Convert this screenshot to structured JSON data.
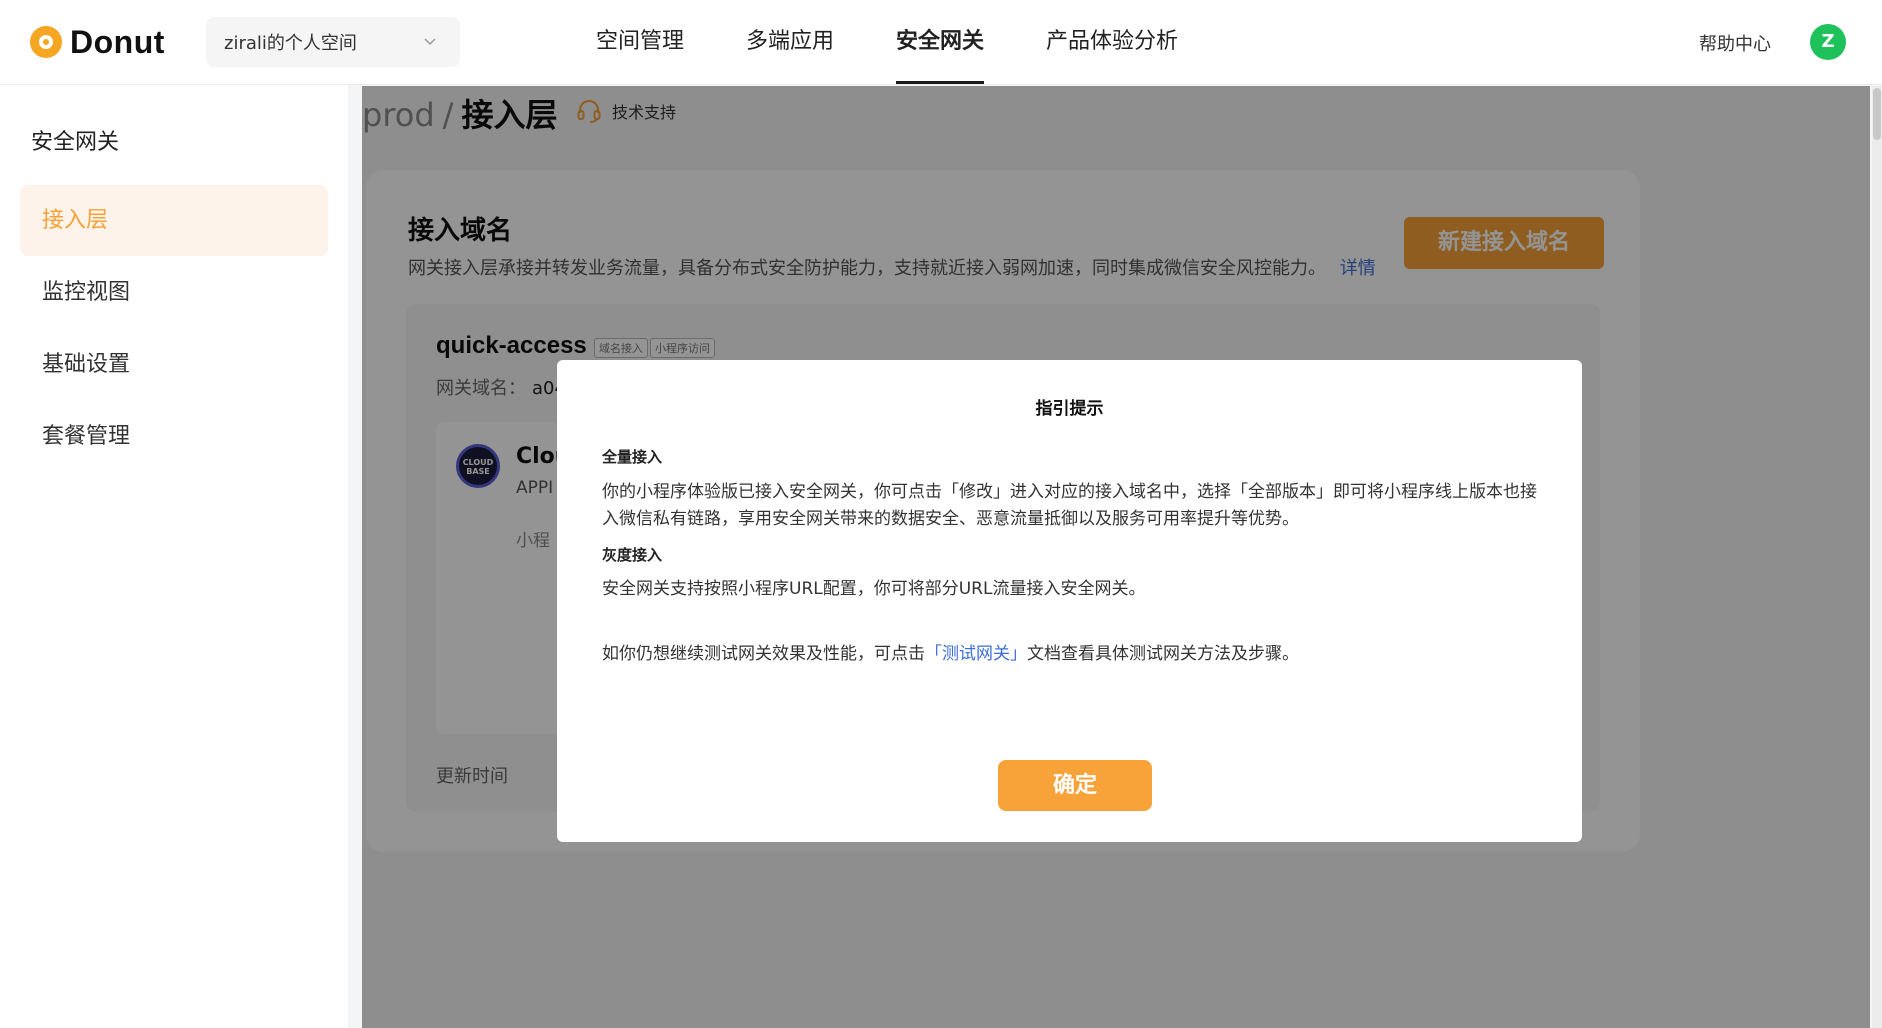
{
  "header": {
    "logo_text": "Donut",
    "space_selector": "zirali的个人空间",
    "nav": [
      "空间管理",
      "多端应用",
      "安全网关",
      "产品体验分析"
    ],
    "nav_active": "安全网关",
    "help": "帮助中心",
    "avatar_letter": "Z"
  },
  "sidebar": {
    "title": "安全网关",
    "items": [
      {
        "label": "接入层",
        "active": true
      },
      {
        "label": "监控视图",
        "active": false
      },
      {
        "label": "基础设置",
        "active": false
      },
      {
        "label": "套餐管理",
        "active": false
      }
    ]
  },
  "breadcrumb": {
    "env": "prod",
    "separator": "/",
    "current": "接入层"
  },
  "support_label": "技术支持",
  "card": {
    "title": "接入域名",
    "description": "网关接入层承接并转发业务流量，具备分布式安全防护能力，支持就近接入弱网加速，同时集成微信安全风控能力。",
    "details_link": "详情",
    "new_button": "新建接入域名",
    "domain": {
      "name": "quick-access",
      "tags": [
        "域名接入",
        "小程序访问"
      ],
      "gateway_label": "网关域名：",
      "gateway_value": "a04",
      "app": {
        "logo_text": "CLOUD BASE",
        "name": "Clou",
        "id": "APPI",
        "desc": "小程"
      },
      "update_label": "更新时间"
    }
  },
  "modal": {
    "title": "指引提示",
    "section1_title": "全量接入",
    "section1_text": "你的小程序体验版已接入安全网关，你可点击「修改」进入对应的接入域名中，选择「全部版本」即可将小程序线上版本也接入微信私有链路，享用安全网关带来的数据安全、恶意流量抵御以及服务可用率提升等优势。",
    "section2_title": "灰度接入",
    "section2_text": "安全网关支持按照小程序URL配置，你可将部分URL流量接入安全网关。",
    "note_before": "如你仍想继续测试网关效果及性能，可点击",
    "note_link": "「测试网关」",
    "note_after": "文档查看具体测试网关方法及步骤。",
    "confirm": "确定"
  },
  "colors": {
    "accent": "#f5a136",
    "link": "#3c6fd9",
    "avatar": "#1fc15a",
    "overlay": "rgba(0,0,0,0.42)"
  },
  "icons": [
    "logo-icon",
    "chevron-down-icon",
    "headset-icon",
    "cloudbase-icon"
  ]
}
